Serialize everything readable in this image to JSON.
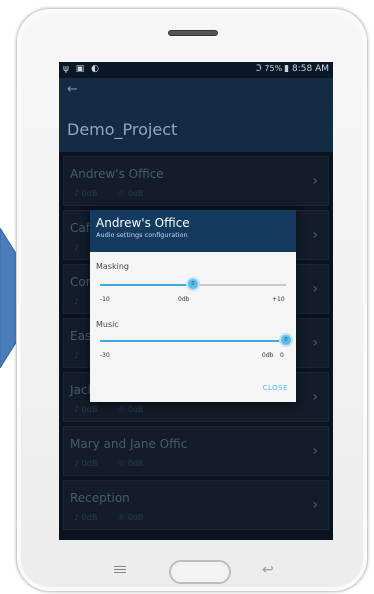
{
  "statusbar": {
    "left_icons": "ψ ▣ ◐",
    "signal": "ℑ",
    "battery": "75%",
    "battery_icon": "▮",
    "time": "8:58 AM"
  },
  "appbar": {
    "back_glyph": "←",
    "title": "Demo_Project"
  },
  "rooms": [
    {
      "name": "Andrew's Office",
      "music": "♪ 0dB",
      "masking": "℗ 0dB"
    },
    {
      "name": "Cafe",
      "music": "♪",
      "masking": ""
    },
    {
      "name": "Con",
      "music": "♪",
      "masking": ""
    },
    {
      "name": "East",
      "music": "♪",
      "masking": ""
    },
    {
      "name": "Jack",
      "music": "♪ 0dB",
      "masking": "℗ 0dB"
    },
    {
      "name": "Mary and Jane Offic",
      "music": "♪ 0dB",
      "masking": "℗ 0dB"
    },
    {
      "name": "Reception",
      "music": "♪ 0dB",
      "masking": "℗ 0dB"
    }
  ],
  "chevron": "›",
  "dialog": {
    "title": "Andrew's Office",
    "subtitle": "Audio settings configuration",
    "masking": {
      "label": "Masking",
      "min": "-10",
      "mid": "0db",
      "max": "+10",
      "value_fraction": 0.5,
      "thumb_label": "0"
    },
    "music": {
      "label": "Music",
      "min": "-30",
      "right_label": "0db",
      "value": "0",
      "value_fraction": 1.0,
      "thumb_label": "0"
    },
    "close_label": "CLOSE"
  },
  "colors": {
    "accent": "#3fa8e0",
    "appbar": "#142b44",
    "dialog_header": "#153a5f",
    "arrow": "#4a7ebb"
  },
  "icons": {
    "menu": "menu-icon",
    "home": "home-button",
    "back": "back-icon"
  },
  "nav": {
    "back_glyph": "↩"
  }
}
